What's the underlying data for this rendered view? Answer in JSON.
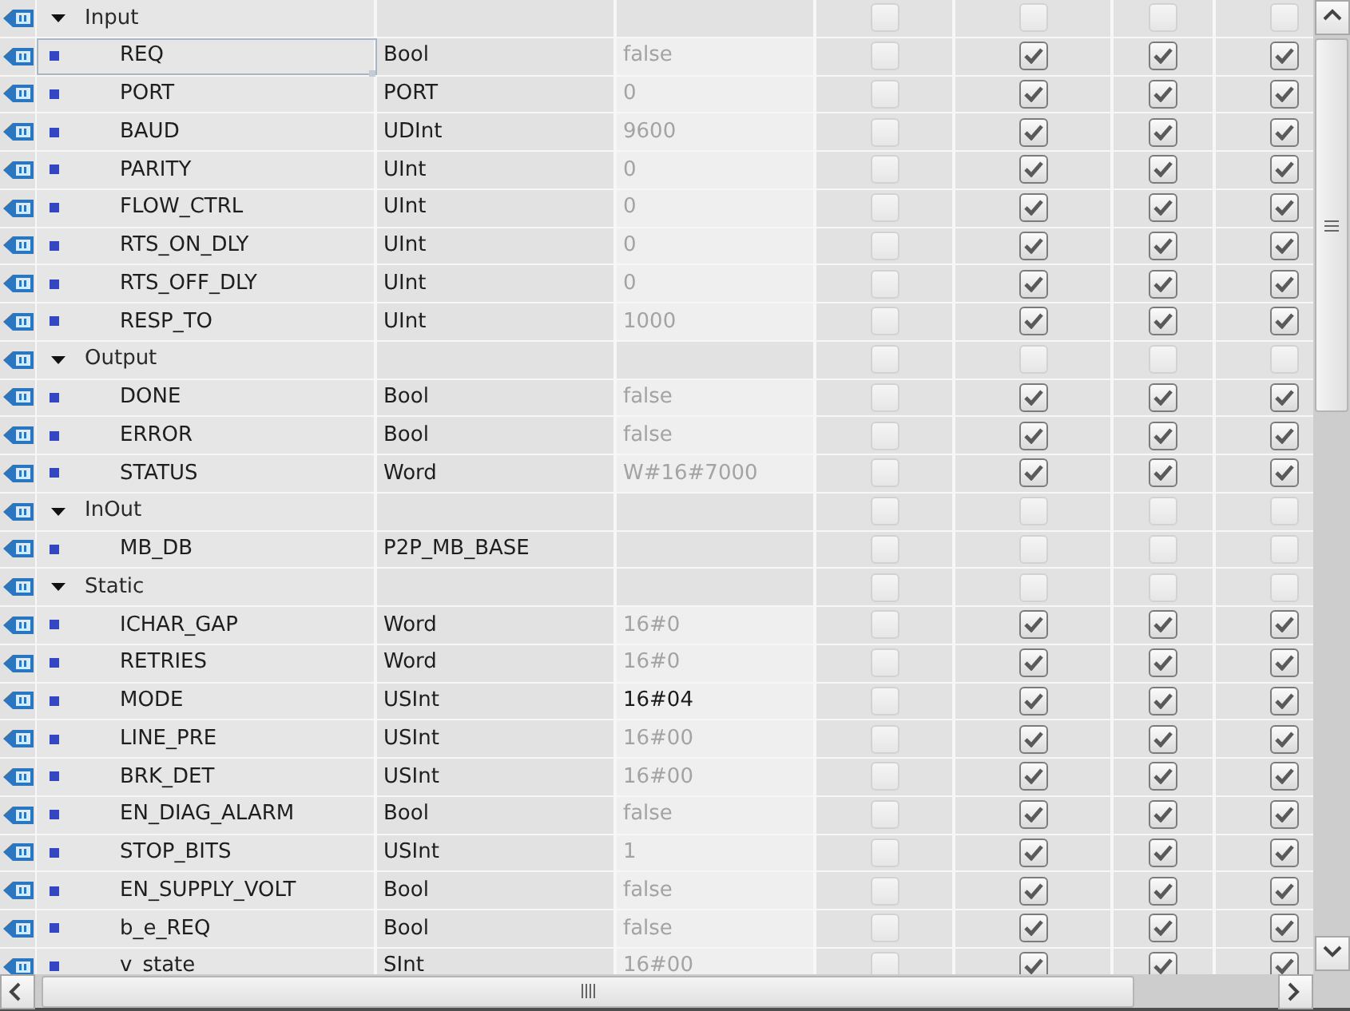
{
  "sections": [
    {
      "name": "Input",
      "expanded": true,
      "selected": false,
      "checks": [
        false,
        false,
        false,
        false
      ],
      "children": [
        {
          "name": "REQ",
          "data_type": "Bool",
          "default_value": "false",
          "modified": false,
          "selected": true,
          "checks": [
            false,
            true,
            true,
            true
          ]
        },
        {
          "name": "PORT",
          "data_type": "PORT",
          "default_value": "0",
          "modified": false,
          "selected": false,
          "checks": [
            false,
            true,
            true,
            true
          ]
        },
        {
          "name": "BAUD",
          "data_type": "UDInt",
          "default_value": "9600",
          "modified": false,
          "selected": false,
          "checks": [
            false,
            true,
            true,
            true
          ]
        },
        {
          "name": "PARITY",
          "data_type": "UInt",
          "default_value": "0",
          "modified": false,
          "selected": false,
          "checks": [
            false,
            true,
            true,
            true
          ]
        },
        {
          "name": "FLOW_CTRL",
          "data_type": "UInt",
          "default_value": "0",
          "modified": false,
          "selected": false,
          "checks": [
            false,
            true,
            true,
            true
          ]
        },
        {
          "name": "RTS_ON_DLY",
          "data_type": "UInt",
          "default_value": "0",
          "modified": false,
          "selected": false,
          "checks": [
            false,
            true,
            true,
            true
          ]
        },
        {
          "name": "RTS_OFF_DLY",
          "data_type": "UInt",
          "default_value": "0",
          "modified": false,
          "selected": false,
          "checks": [
            false,
            true,
            true,
            true
          ]
        },
        {
          "name": "RESP_TO",
          "data_type": "UInt",
          "default_value": "1000",
          "modified": false,
          "selected": false,
          "checks": [
            false,
            true,
            true,
            true
          ]
        }
      ]
    },
    {
      "name": "Output",
      "expanded": true,
      "selected": false,
      "checks": [
        false,
        false,
        false,
        false
      ],
      "children": [
        {
          "name": "DONE",
          "data_type": "Bool",
          "default_value": "false",
          "modified": false,
          "selected": false,
          "checks": [
            false,
            true,
            true,
            true
          ]
        },
        {
          "name": "ERROR",
          "data_type": "Bool",
          "default_value": "false",
          "modified": false,
          "selected": false,
          "checks": [
            false,
            true,
            true,
            true
          ]
        },
        {
          "name": "STATUS",
          "data_type": "Word",
          "default_value": "W#16#7000",
          "modified": false,
          "selected": false,
          "checks": [
            false,
            true,
            true,
            true
          ]
        }
      ]
    },
    {
      "name": "InOut",
      "expanded": true,
      "selected": false,
      "checks": [
        false,
        false,
        false,
        false
      ],
      "children": [
        {
          "name": "MB_DB",
          "data_type": "P2P_MB_BASE",
          "selected": false,
          "checks": [
            false,
            false,
            false,
            false
          ]
        }
      ]
    },
    {
      "name": "Static",
      "expanded": true,
      "selected": false,
      "checks": [
        false,
        false,
        false,
        false
      ],
      "children": [
        {
          "name": "ICHAR_GAP",
          "data_type": "Word",
          "default_value": "16#0",
          "modified": false,
          "selected": false,
          "checks": [
            false,
            true,
            true,
            true
          ]
        },
        {
          "name": "RETRIES",
          "data_type": "Word",
          "default_value": "16#0",
          "modified": false,
          "selected": false,
          "checks": [
            false,
            true,
            true,
            true
          ]
        },
        {
          "name": "MODE",
          "data_type": "USInt",
          "default_value": "16#04",
          "modified": true,
          "selected": false,
          "checks": [
            false,
            true,
            true,
            true
          ]
        },
        {
          "name": "LINE_PRE",
          "data_type": "USInt",
          "default_value": "16#00",
          "modified": false,
          "selected": false,
          "checks": [
            false,
            true,
            true,
            true
          ]
        },
        {
          "name": "BRK_DET",
          "data_type": "USInt",
          "default_value": "16#00",
          "modified": false,
          "selected": false,
          "checks": [
            false,
            true,
            true,
            true
          ]
        },
        {
          "name": "EN_DIAG_ALARM",
          "data_type": "Bool",
          "default_value": "false",
          "modified": false,
          "selected": false,
          "checks": [
            false,
            true,
            true,
            true
          ]
        },
        {
          "name": "STOP_BITS",
          "data_type": "USInt",
          "default_value": "1",
          "modified": false,
          "selected": false,
          "checks": [
            false,
            true,
            true,
            true
          ]
        },
        {
          "name": "EN_SUPPLY_VOLT",
          "data_type": "Bool",
          "default_value": "false",
          "modified": false,
          "selected": false,
          "checks": [
            false,
            true,
            true,
            true
          ]
        },
        {
          "name": "b_e_REQ",
          "data_type": "Bool",
          "default_value": "false",
          "modified": false,
          "selected": false,
          "checks": [
            false,
            true,
            true,
            true
          ]
        },
        {
          "name": "v_state",
          "data_type": "SInt",
          "default_value": "16#00",
          "modified": false,
          "selected": false,
          "checks": [
            false,
            true,
            true,
            true
          ]
        }
      ]
    }
  ]
}
